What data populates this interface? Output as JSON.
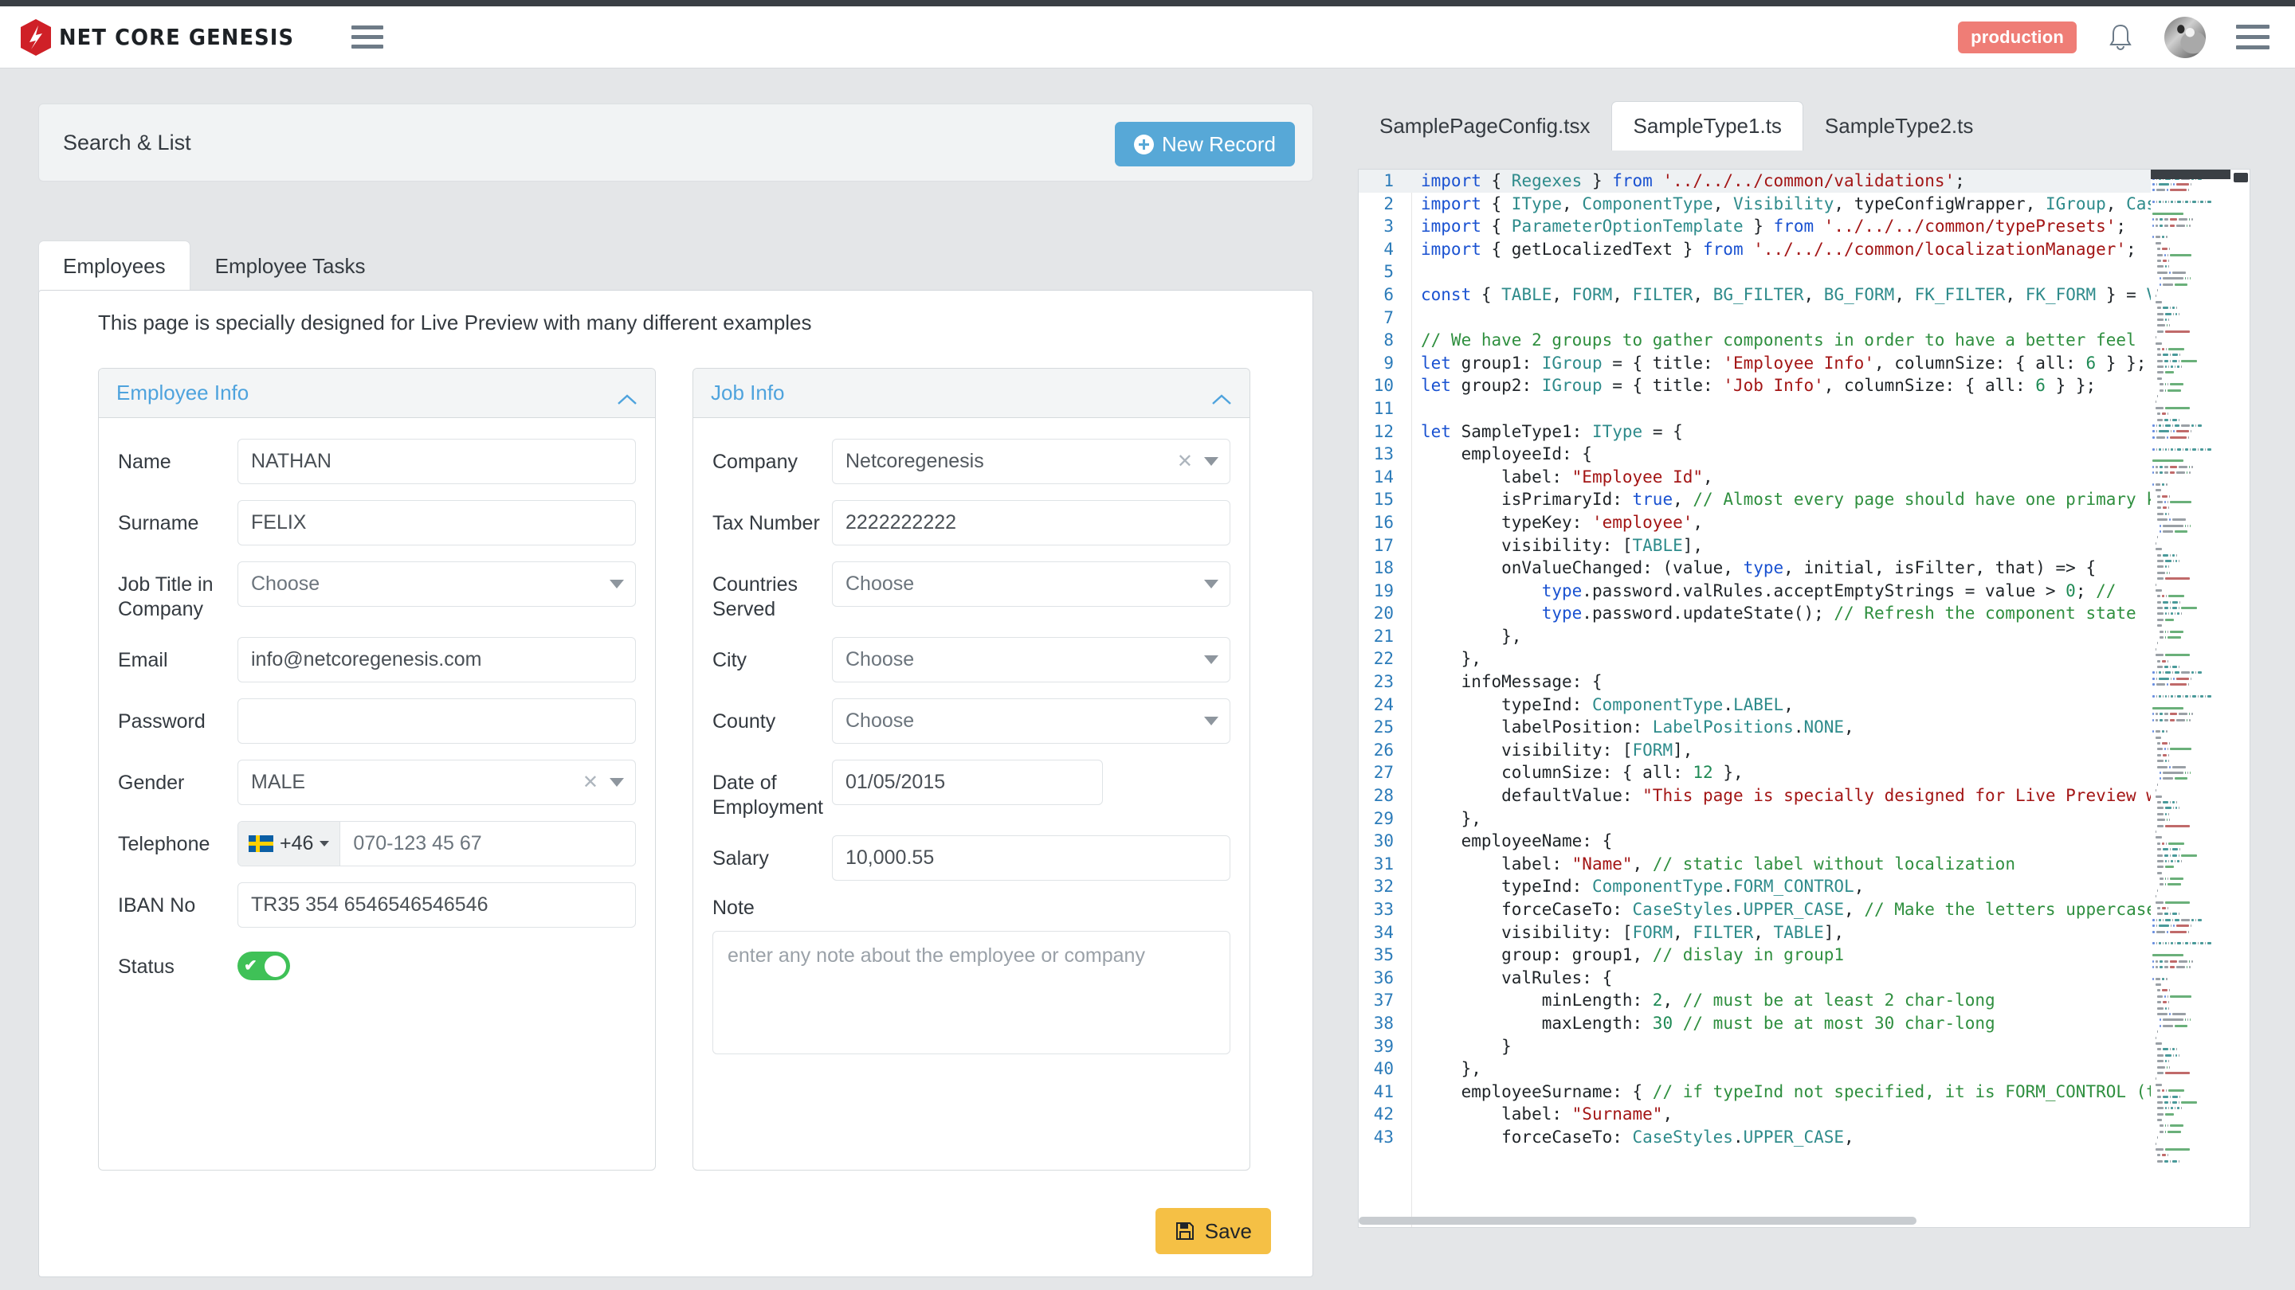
{
  "header": {
    "brand": "NET CORE GENESIS",
    "env_badge": "production",
    "menu_icon": "hamburger-icon",
    "bell_icon": "bell-icon",
    "avatar_icon": "user-avatar"
  },
  "search_list": {
    "title": "Search & List",
    "new_record_label": "New Record"
  },
  "tabs": [
    {
      "label": "Employees",
      "active": true
    },
    {
      "label": "Employee Tasks",
      "active": false
    }
  ],
  "info_message": "This page is specially designed for Live Preview with many different examples",
  "groups": [
    {
      "title": "Employee Info",
      "fields": [
        {
          "label": "Name",
          "type": "text",
          "value": "NATHAN",
          "placeholder": ""
        },
        {
          "label": "Surname",
          "type": "text",
          "value": "FELIX",
          "placeholder": ""
        },
        {
          "label": "Job Title in Company",
          "type": "select",
          "value": "Choose",
          "clearable": false
        },
        {
          "label": "Email",
          "type": "text",
          "value": "info@netcoregenesis.com",
          "placeholder": ""
        },
        {
          "label": "Password",
          "type": "password",
          "value": "",
          "placeholder": ""
        },
        {
          "label": "Gender",
          "type": "select",
          "value": "MALE",
          "clearable": true
        },
        {
          "label": "Telephone",
          "type": "phone",
          "country_code": "+46",
          "flag": "sweden-flag",
          "value": "070-123 45 67"
        },
        {
          "label": "IBAN No",
          "type": "text",
          "value": "TR35 354 6546546546546",
          "placeholder": ""
        },
        {
          "label": "Status",
          "type": "toggle",
          "value": "on"
        }
      ]
    },
    {
      "title": "Job Info",
      "fields": [
        {
          "label": "Company",
          "type": "select",
          "value": "Netcoregenesis",
          "clearable": true
        },
        {
          "label": "Tax Number",
          "type": "text",
          "value": "2222222222",
          "placeholder": ""
        },
        {
          "label": "Countries Served",
          "type": "select",
          "value": "Choose",
          "clearable": false
        },
        {
          "label": "City",
          "type": "select",
          "value": "Choose",
          "clearable": false
        },
        {
          "label": "County",
          "type": "select",
          "value": "Choose",
          "clearable": false
        },
        {
          "label": "Date of Employment",
          "type": "date",
          "value": "01/05/2015",
          "placeholder": ""
        },
        {
          "label": "Salary",
          "type": "text",
          "value": "10,000.55",
          "placeholder": ""
        },
        {
          "label": "Note",
          "type": "textarea",
          "value": "",
          "placeholder": "enter any note about the employee or company"
        }
      ]
    }
  ],
  "save_label": "Save",
  "editor": {
    "tabs": [
      {
        "label": "SamplePageConfig.tsx",
        "active": false
      },
      {
        "label": "SampleType1.ts",
        "active": true
      },
      {
        "label": "SampleType2.ts",
        "active": false
      }
    ],
    "status_icon": "check-icon",
    "lines": [
      {
        "n": 1,
        "tokens": [
          [
            "kw",
            "import"
          ],
          [
            "pln",
            " { "
          ],
          [
            "typ",
            "Regexes"
          ],
          [
            "pln",
            " } "
          ],
          [
            "kw",
            "from"
          ],
          [
            "pln",
            " "
          ],
          [
            "str",
            "'../../../common/validations'"
          ],
          [
            "pln",
            ";"
          ]
        ]
      },
      {
        "n": 2,
        "tokens": [
          [
            "kw",
            "import"
          ],
          [
            "pln",
            " { "
          ],
          [
            "typ",
            "IType"
          ],
          [
            "pln",
            ", "
          ],
          [
            "typ",
            "ComponentType"
          ],
          [
            "pln",
            ", "
          ],
          [
            "typ",
            "Visibility"
          ],
          [
            "pln",
            ", typeConfigWrapper, "
          ],
          [
            "typ",
            "IGroup"
          ],
          [
            "pln",
            ", "
          ],
          [
            "typ",
            "CaseStyles"
          ]
        ]
      },
      {
        "n": 3,
        "tokens": [
          [
            "kw",
            "import"
          ],
          [
            "pln",
            " { "
          ],
          [
            "typ",
            "ParameterOptionTemplate"
          ],
          [
            "pln",
            " } "
          ],
          [
            "kw",
            "from"
          ],
          [
            "pln",
            " "
          ],
          [
            "str",
            "'../../../common/typePresets'"
          ],
          [
            "pln",
            ";"
          ]
        ]
      },
      {
        "n": 4,
        "tokens": [
          [
            "kw",
            "import"
          ],
          [
            "pln",
            " { getLocalizedText } "
          ],
          [
            "kw",
            "from"
          ],
          [
            "pln",
            " "
          ],
          [
            "str",
            "'../../../common/localizationManager'"
          ],
          [
            "pln",
            ";"
          ]
        ]
      },
      {
        "n": 5,
        "tokens": []
      },
      {
        "n": 6,
        "tokens": [
          [
            "kw",
            "const"
          ],
          [
            "pln",
            " { "
          ],
          [
            "typ",
            "TABLE"
          ],
          [
            "pln",
            ", "
          ],
          [
            "typ",
            "FORM"
          ],
          [
            "pln",
            ", "
          ],
          [
            "typ",
            "FILTER"
          ],
          [
            "pln",
            ", "
          ],
          [
            "typ",
            "BG_FILTER"
          ],
          [
            "pln",
            ", "
          ],
          [
            "typ",
            "BG_FORM"
          ],
          [
            "pln",
            ", "
          ],
          [
            "typ",
            "FK_FILTER"
          ],
          [
            "pln",
            ", "
          ],
          [
            "typ",
            "FK_FORM"
          ],
          [
            "pln",
            " } = "
          ],
          [
            "typ",
            "Visibili"
          ]
        ]
      },
      {
        "n": 7,
        "tokens": []
      },
      {
        "n": 8,
        "tokens": [
          [
            "cmt",
            "// We have 2 groups to gather components in order to have a better feel"
          ]
        ]
      },
      {
        "n": 9,
        "tokens": [
          [
            "kw",
            "let"
          ],
          [
            "pln",
            " group1: "
          ],
          [
            "typ",
            "IGroup"
          ],
          [
            "pln",
            " = { title: "
          ],
          [
            "str",
            "'Employee Info'"
          ],
          [
            "pln",
            ", columnSize: { all: "
          ],
          [
            "num",
            "6"
          ],
          [
            "pln",
            " } };"
          ]
        ]
      },
      {
        "n": 10,
        "tokens": [
          [
            "kw",
            "let"
          ],
          [
            "pln",
            " group2: "
          ],
          [
            "typ",
            "IGroup"
          ],
          [
            "pln",
            " = { title: "
          ],
          [
            "str",
            "'Job Info'"
          ],
          [
            "pln",
            ", columnSize: { all: "
          ],
          [
            "num",
            "6"
          ],
          [
            "pln",
            " } };"
          ]
        ]
      },
      {
        "n": 11,
        "tokens": []
      },
      {
        "n": 12,
        "tokens": [
          [
            "kw",
            "let"
          ],
          [
            "pln",
            " SampleType1: "
          ],
          [
            "typ",
            "IType"
          ],
          [
            "pln",
            " = {"
          ]
        ]
      },
      {
        "n": 13,
        "tokens": [
          [
            "pln",
            "    employeeId: {"
          ]
        ]
      },
      {
        "n": 14,
        "tokens": [
          [
            "pln",
            "        label: "
          ],
          [
            "str",
            "\"Employee Id\""
          ],
          [
            "pln",
            ","
          ]
        ]
      },
      {
        "n": 15,
        "tokens": [
          [
            "pln",
            "        isPrimaryId: "
          ],
          [
            "kw",
            "true"
          ],
          [
            "pln",
            ", "
          ],
          [
            "cmt",
            "// Almost every page should have one primary key"
          ]
        ]
      },
      {
        "n": 16,
        "tokens": [
          [
            "pln",
            "        typeKey: "
          ],
          [
            "str",
            "'employee'"
          ],
          [
            "pln",
            ","
          ]
        ]
      },
      {
        "n": 17,
        "tokens": [
          [
            "pln",
            "        visibility: ["
          ],
          [
            "typ",
            "TABLE"
          ],
          [
            "pln",
            "],"
          ]
        ]
      },
      {
        "n": 18,
        "tokens": [
          [
            "pln",
            "        onValueChanged: (value, "
          ],
          [
            "kw",
            "type"
          ],
          [
            "pln",
            ", initial, isFilter, that) => {"
          ]
        ]
      },
      {
        "n": 19,
        "tokens": [
          [
            "pln",
            "            "
          ],
          [
            "kw",
            "type"
          ],
          [
            "pln",
            ".password.valRules.acceptEmptyStrings = value > "
          ],
          [
            "num",
            "0"
          ],
          [
            "pln",
            "; "
          ],
          [
            "cmt",
            "//"
          ]
        ]
      },
      {
        "n": 20,
        "tokens": [
          [
            "pln",
            "            "
          ],
          [
            "kw",
            "type"
          ],
          [
            "pln",
            ".password.updateState(); "
          ],
          [
            "cmt",
            "// Refresh the component state"
          ]
        ]
      },
      {
        "n": 21,
        "tokens": [
          [
            "pln",
            "        },"
          ]
        ]
      },
      {
        "n": 22,
        "tokens": [
          [
            "pln",
            "    },"
          ]
        ]
      },
      {
        "n": 23,
        "tokens": [
          [
            "pln",
            "    infoMessage: {"
          ]
        ]
      },
      {
        "n": 24,
        "tokens": [
          [
            "pln",
            "        typeInd: "
          ],
          [
            "typ",
            "ComponentType"
          ],
          [
            "pln",
            "."
          ],
          [
            "typ",
            "LABEL"
          ],
          [
            "pln",
            ","
          ]
        ]
      },
      {
        "n": 25,
        "tokens": [
          [
            "pln",
            "        labelPosition: "
          ],
          [
            "typ",
            "LabelPositions"
          ],
          [
            "pln",
            "."
          ],
          [
            "typ",
            "NONE"
          ],
          [
            "pln",
            ","
          ]
        ]
      },
      {
        "n": 26,
        "tokens": [
          [
            "pln",
            "        visibility: ["
          ],
          [
            "typ",
            "FORM"
          ],
          [
            "pln",
            "],"
          ]
        ]
      },
      {
        "n": 27,
        "tokens": [
          [
            "pln",
            "        columnSize: { all: "
          ],
          [
            "num",
            "12"
          ],
          [
            "pln",
            " },"
          ]
        ]
      },
      {
        "n": 28,
        "tokens": [
          [
            "pln",
            "        defaultValue: "
          ],
          [
            "str",
            "\"This page is specially designed for Live Preview with man"
          ]
        ]
      },
      {
        "n": 29,
        "tokens": [
          [
            "pln",
            "    },"
          ]
        ]
      },
      {
        "n": 30,
        "tokens": [
          [
            "pln",
            "    employeeName: {"
          ]
        ]
      },
      {
        "n": 31,
        "tokens": [
          [
            "pln",
            "        label: "
          ],
          [
            "str",
            "\"Name\""
          ],
          [
            "pln",
            ", "
          ],
          [
            "cmt",
            "// static label without localization"
          ]
        ]
      },
      {
        "n": 32,
        "tokens": [
          [
            "pln",
            "        typeInd: "
          ],
          [
            "typ",
            "ComponentType"
          ],
          [
            "pln",
            "."
          ],
          [
            "typ",
            "FORM_CONTROL"
          ],
          [
            "pln",
            ","
          ]
        ]
      },
      {
        "n": 33,
        "tokens": [
          [
            "pln",
            "        forceCaseTo: "
          ],
          [
            "typ",
            "CaseStyles"
          ],
          [
            "pln",
            "."
          ],
          [
            "typ",
            "UPPER_CASE"
          ],
          [
            "pln",
            ", "
          ],
          [
            "cmt",
            "// Make the letters uppercase as typ"
          ]
        ]
      },
      {
        "n": 34,
        "tokens": [
          [
            "pln",
            "        visibility: ["
          ],
          [
            "typ",
            "FORM"
          ],
          [
            "pln",
            ", "
          ],
          [
            "typ",
            "FILTER"
          ],
          [
            "pln",
            ", "
          ],
          [
            "typ",
            "TABLE"
          ],
          [
            "pln",
            "],"
          ]
        ]
      },
      {
        "n": 35,
        "tokens": [
          [
            "pln",
            "        group: group1, "
          ],
          [
            "cmt",
            "// dislay in group1"
          ]
        ]
      },
      {
        "n": 36,
        "tokens": [
          [
            "pln",
            "        valRules: {"
          ]
        ]
      },
      {
        "n": 37,
        "tokens": [
          [
            "pln",
            "            minLength: "
          ],
          [
            "num",
            "2"
          ],
          [
            "pln",
            ", "
          ],
          [
            "cmt",
            "// must be at least 2 char-long"
          ]
        ]
      },
      {
        "n": 38,
        "tokens": [
          [
            "pln",
            "            maxLength: "
          ],
          [
            "num",
            "30"
          ],
          [
            "pln",
            " "
          ],
          [
            "cmt",
            "// must be at most 30 char-long"
          ]
        ]
      },
      {
        "n": 39,
        "tokens": [
          [
            "pln",
            "        }"
          ]
        ]
      },
      {
        "n": 40,
        "tokens": [
          [
            "pln",
            "    },"
          ]
        ]
      },
      {
        "n": 41,
        "tokens": [
          [
            "pln",
            "    employeeSurname: { "
          ],
          [
            "cmt",
            "// if typeInd not specified, it is FORM_CONTROL (text-inp"
          ]
        ]
      },
      {
        "n": 42,
        "tokens": [
          [
            "pln",
            "        label: "
          ],
          [
            "str",
            "\"Surname\""
          ],
          [
            "pln",
            ","
          ]
        ]
      },
      {
        "n": 43,
        "tokens": [
          [
            "pln",
            "        forceCaseTo: "
          ],
          [
            "typ",
            "CaseStyles"
          ],
          [
            "pln",
            "."
          ],
          [
            "typ",
            "UPPER_CASE"
          ],
          [
            "pln",
            ","
          ]
        ]
      }
    ]
  }
}
